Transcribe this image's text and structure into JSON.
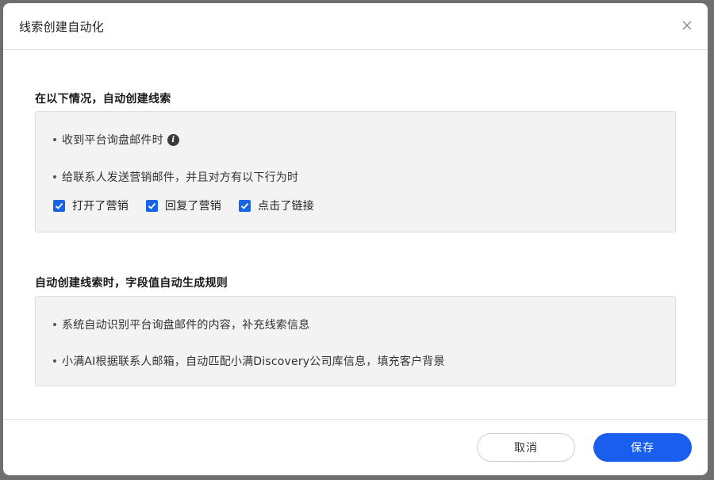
{
  "dialog": {
    "title": "线索创建自动化",
    "close_icon": "close-icon"
  },
  "section1": {
    "title": "在以下情况，自动创建线索",
    "rule1": "收到平台询盘邮件时",
    "rule1_icon": "info-icon",
    "rule2": "给联系人发送营销邮件，并且对方有以下行为时",
    "checkboxes": [
      {
        "label": "打开了营销",
        "checked": true
      },
      {
        "label": "回复了营销",
        "checked": true
      },
      {
        "label": "点击了链接",
        "checked": true
      }
    ]
  },
  "section2": {
    "title": "自动创建线索时，字段值自动生成规则",
    "rule1": "系统自动识别平台询盘邮件的内容，补充线索信息",
    "rule2": "小满AI根据联系人邮箱，自动匹配小满Discovery公司库信息，填充客户背景"
  },
  "footer": {
    "cancel_label": "取消",
    "save_label": "保存"
  },
  "colors": {
    "primary": "#1a5ef0",
    "checkbox": "#1765e6",
    "panel_bg": "#f3f3f3"
  }
}
